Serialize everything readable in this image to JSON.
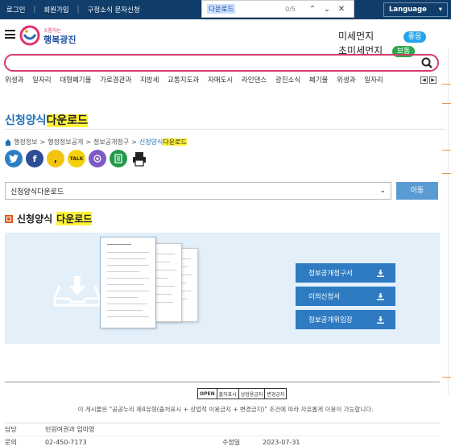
{
  "topbar": {
    "links": [
      "로그인",
      "회원가입",
      "구정소식 문자신청"
    ],
    "language": "Language"
  },
  "findbar": {
    "query": "다운로드",
    "count": "0/5"
  },
  "header": {
    "logo_text": "소통하는 행복광진",
    "air": [
      {
        "label": "미세먼지",
        "status": "좋음",
        "color": "#27a3e6"
      },
      {
        "label": "초미세먼지",
        "status": "보통",
        "color": "#2aa84a"
      }
    ]
  },
  "search": {
    "placeholder": ""
  },
  "keywords": [
    "위생과",
    "일자리",
    "대형폐기물",
    "가로경관과",
    "지방세",
    "교통지도과",
    "자매도시",
    "라인댄스",
    "광진소식",
    "폐기물",
    "위생과",
    "일자리"
  ],
  "page": {
    "title_plain": "신청양식",
    "title_hl": "다운로드",
    "breadcrumb": [
      "행정정보",
      "행정정보공개",
      "정보공개청구"
    ],
    "crumb_current_plain": "신청양식",
    "crumb_current_hl": "다운로드"
  },
  "select": {
    "value": "신청양식다운로드",
    "go_label": "이동"
  },
  "section": {
    "title_plain": "신청양식",
    "title_hl": "다운로드"
  },
  "downloads": [
    "정보공개청구서",
    "이의신청서",
    "정보공개위임장"
  ],
  "footer": {
    "kogl": [
      "OPEN",
      "공공누리",
      "출처표시",
      "상업용금지",
      "변경금지"
    ],
    "license": "이 게시물은 \"공공누리 제4유형(출처표시 + 상업적 이용금지 + 변경금지)\" 조건에 따라 자유롭게 이용이 가능합니다.",
    "dept_label": "담당",
    "dept_value": "민원여권과 임미영",
    "phone_label": "문의",
    "phone_value": "02-450-7173",
    "updated_label": "수정일",
    "updated_value": "2023-07-31"
  }
}
